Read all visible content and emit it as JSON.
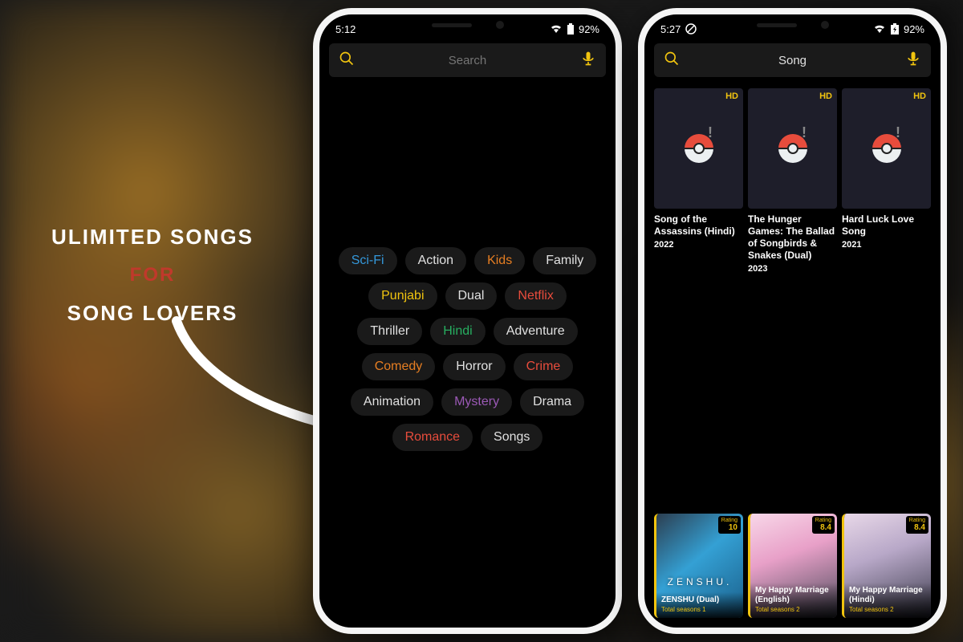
{
  "tagline": {
    "line1": "ULIMITED SONGS",
    "line2": "FOR",
    "line3": "SONG LOVERS"
  },
  "phone1": {
    "time": "5:12",
    "battery": "92%",
    "search_placeholder": "Search",
    "chips": [
      {
        "label": "Sci-Fi",
        "color": "#3498db"
      },
      {
        "label": "Action",
        "color": "#e0e0e0"
      },
      {
        "label": "Kids",
        "color": "#e67e22"
      },
      {
        "label": "Family",
        "color": "#e0e0e0"
      },
      {
        "label": "Punjabi",
        "color": "#f1c40f"
      },
      {
        "label": "Dual",
        "color": "#e0e0e0"
      },
      {
        "label": "Netflix",
        "color": "#e74c3c"
      },
      {
        "label": "Thriller",
        "color": "#e0e0e0"
      },
      {
        "label": "Hindi",
        "color": "#27ae60"
      },
      {
        "label": "Adventure",
        "color": "#e0e0e0"
      },
      {
        "label": "Comedy",
        "color": "#e67e22"
      },
      {
        "label": "Horror",
        "color": "#e0e0e0"
      },
      {
        "label": "Crime",
        "color": "#e74c3c"
      },
      {
        "label": "Animation",
        "color": "#e0e0e0"
      },
      {
        "label": "Mystery",
        "color": "#9b59b6"
      },
      {
        "label": "Drama",
        "color": "#e0e0e0"
      },
      {
        "label": "Romance",
        "color": "#e74c3c"
      },
      {
        "label": "Songs",
        "color": "#e0e0e0"
      }
    ]
  },
  "phone2": {
    "time": "5:27",
    "battery": "92%",
    "search_value": "Song",
    "hd_label": "HD",
    "results": [
      {
        "title": "Song of the Assassins (Hindi)",
        "year": "2022"
      },
      {
        "title": "The Hunger Games: The Ballad of Songbirds & Snakes (Dual)",
        "year": "2023"
      },
      {
        "title": "Hard Luck Love Song",
        "year": "2021"
      }
    ],
    "rating_label": "Rating",
    "seasons_label": "Total seasons",
    "bottom": [
      {
        "title": "ZENSHU (Dual)",
        "seasons": "1",
        "rating": "10",
        "brand": "ZENSHU.",
        "art": "a1"
      },
      {
        "title": "My Happy Marriage (English)",
        "seasons": "2",
        "rating": "8.4",
        "brand": "",
        "art": "a2"
      },
      {
        "title": "My Happy Marriage (Hindi)",
        "seasons": "2",
        "rating": "8.4",
        "brand": "",
        "art": "a3"
      }
    ]
  }
}
